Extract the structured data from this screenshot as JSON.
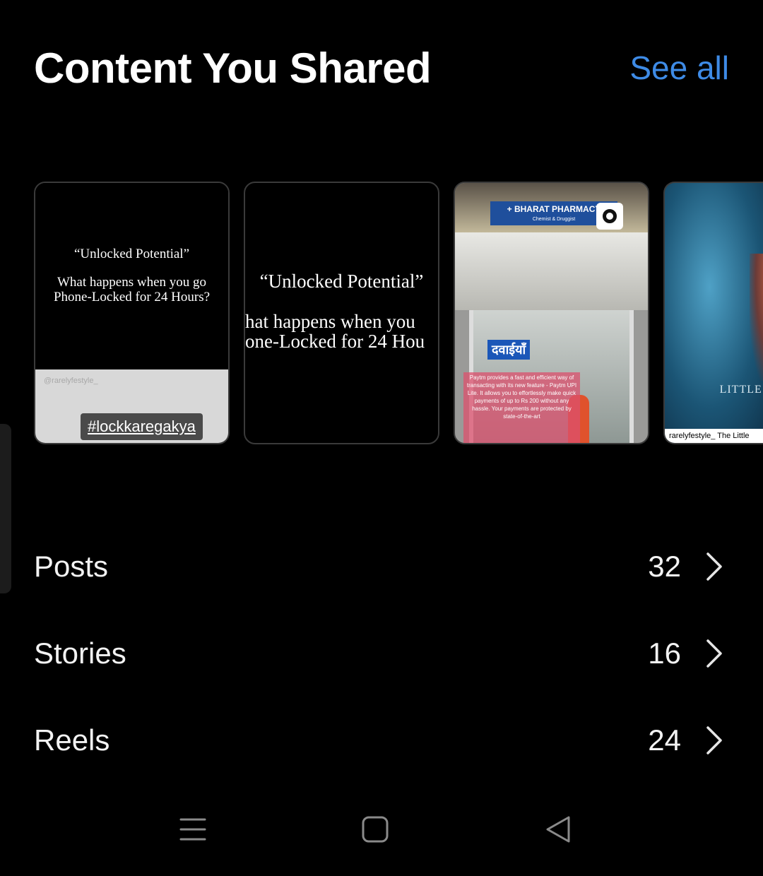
{
  "header": {
    "title": "Content You Shared",
    "see_all": "See all"
  },
  "colors": {
    "accent": "#3e8be6",
    "background": "#000000",
    "text": "#f2f2f2"
  },
  "thumbnails": [
    {
      "title": "“Unlocked Potential”",
      "body_line1": "What happens when you go",
      "body_line2": "Phone-Locked for 24 Hours?",
      "handle": "@rarelyfestyle_",
      "hashtag": "#lockkaregakya"
    },
    {
      "title": "“Unlocked Potential”",
      "body_line1": "hat happens when you",
      "body_line2": "one-Locked for 24 Hou"
    },
    {
      "sign": "+ BHARAT PHARMACY",
      "sign_sub": "Chemist & Druggist",
      "hindi": "दवाईयाँ",
      "overlay_text": "Paytm provides a fast and efficient way of transacting with its new feature - Paytm UPI Lite. It allows you to effortlessly make quick payments of up to Rs 200 without any hassle. Your payments are protected by state-of-the-art"
    },
    {
      "logo": "LITTLE M",
      "caption": "rarelyfestyle_ The Little"
    }
  ],
  "rows": [
    {
      "label": "Posts",
      "count": "32"
    },
    {
      "label": "Stories",
      "count": "16"
    },
    {
      "label": "Reels",
      "count": "24"
    }
  ],
  "navbar": {
    "icons": [
      "menu-icon",
      "home-square-icon",
      "back-triangle-icon"
    ]
  }
}
